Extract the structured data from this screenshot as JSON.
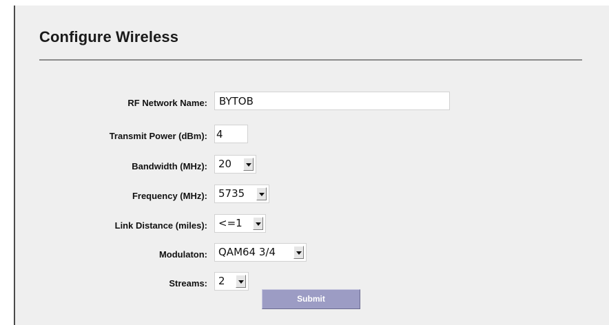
{
  "page": {
    "title": "Configure Wireless"
  },
  "form": {
    "network_name": {
      "label": "RF Network Name:",
      "value": "BYTOB"
    },
    "transmit_power": {
      "label": "Transmit Power (dBm):",
      "value": "4"
    },
    "bandwidth": {
      "label": "Bandwidth (MHz):",
      "selected": "20"
    },
    "frequency": {
      "label": "Frequency (MHz):",
      "selected": "5735"
    },
    "link_distance": {
      "label": "Link Distance (miles):",
      "selected": "<=1"
    },
    "modulation": {
      "label": "Modulaton:",
      "selected": "QAM64 3/4"
    },
    "streams": {
      "label": "Streams:",
      "selected": "2"
    },
    "submit_label": "Submit"
  },
  "colors": {
    "panel_background": "#efefef",
    "submit_button": "#9c9cc4"
  },
  "icons": {
    "dropdown": "chevron-down-icon"
  }
}
